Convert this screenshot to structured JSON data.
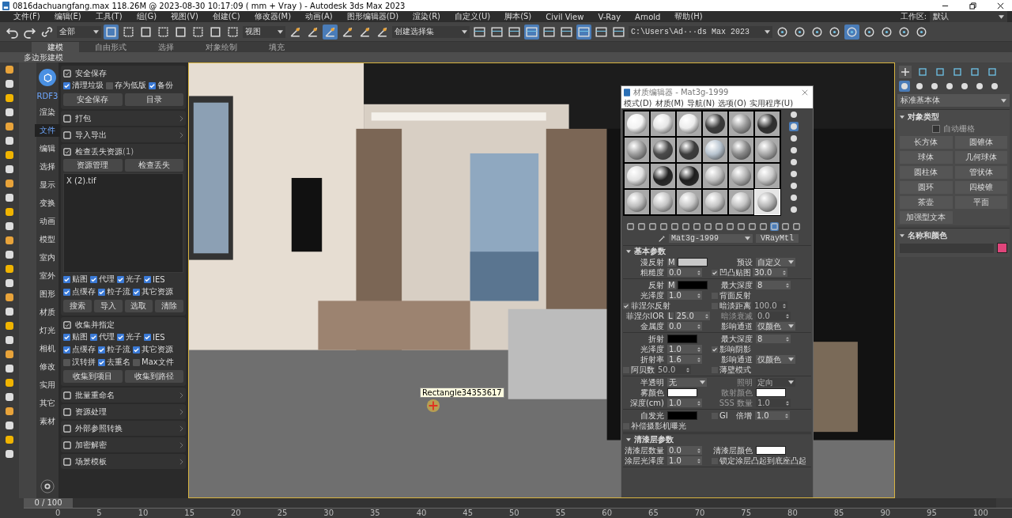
{
  "window": {
    "title": "0816dachuangfang.max  118.26M @ 2023-08-30 10:17:09  ( mm + Vray ) - Autodesk 3ds Max 2023"
  },
  "menu": [
    "文件(F)",
    "编辑(E)",
    "工具(T)",
    "组(G)",
    "视图(V)",
    "创建(C)",
    "修改器(M)",
    "动画(A)",
    "图形编辑器(D)",
    "渲染(R)",
    "自定义(U)",
    "脚本(S)",
    "Civil View",
    "V-Ray",
    "Arnold",
    "帮助(H)"
  ],
  "workspace": {
    "label": "工作区:",
    "value": "默认"
  },
  "toolbar": {
    "selection_filter": "全部",
    "reference_coord": "视图",
    "selection_set": "创建选择集",
    "project_path": "C:\\Users\\Ad···ds Max 2023"
  },
  "ribbon_tabs": [
    {
      "label": "建模",
      "selected": true
    },
    {
      "label": "自由形式",
      "selected": false
    },
    {
      "label": "选择",
      "selected": false
    },
    {
      "label": "对象绘制",
      "selected": false
    },
    {
      "label": "填充",
      "selected": false
    }
  ],
  "ribbon_subtab": "多边形建模",
  "plugin": {
    "logo": "RDF3",
    "nav": [
      {
        "label": "渲染",
        "selected": false
      },
      {
        "label": "文件",
        "selected": true
      },
      {
        "label": "编辑",
        "selected": false
      },
      {
        "label": "选择",
        "selected": false
      },
      {
        "label": "显示",
        "selected": false
      },
      {
        "label": "变换",
        "selected": false
      },
      {
        "label": "动画",
        "selected": false
      },
      {
        "label": "模型",
        "selected": false
      },
      {
        "label": "室内",
        "selected": false
      },
      {
        "label": "室外",
        "selected": false
      },
      {
        "label": "图形",
        "selected": false
      },
      {
        "label": "材质",
        "selected": false
      },
      {
        "label": "灯光",
        "selected": false
      },
      {
        "label": "相机",
        "selected": false
      },
      {
        "label": "修改",
        "selected": false
      },
      {
        "label": "实用",
        "selected": false
      },
      {
        "label": "其它",
        "selected": false
      },
      {
        "label": "素材",
        "selected": false
      }
    ],
    "sections": [
      {
        "title": "安全保存",
        "expanded": true,
        "checkbox_rows": [
          [
            {
              "label": "清理垃圾",
              "checked": true
            },
            {
              "label": "存为低版",
              "checked": false
            },
            {
              "label": "备份",
              "checked": true
            }
          ]
        ],
        "buttons": [
          "安全保存",
          "目录"
        ]
      },
      {
        "title": "打包",
        "expanded": false
      },
      {
        "title": "导入导出",
        "expanded": false
      },
      {
        "title": "检查丢失资源",
        "count": "(1)",
        "expanded": true,
        "top_buttons": [
          "资源管理",
          "检查丢失"
        ],
        "file_list": [
          "X (2).tif"
        ],
        "checkbox_rows": [
          [
            {
              "label": "贴图",
              "checked": true
            },
            {
              "label": "代理",
              "checked": true
            },
            {
              "label": "光子",
              "checked": true
            },
            {
              "label": "IES",
              "checked": true
            }
          ],
          [
            {
              "label": "点缓存",
              "checked": true
            },
            {
              "label": "粒子流",
              "checked": true
            },
            {
              "label": "其它资源",
              "checked": true
            }
          ]
        ],
        "buttons": [
          "搜索",
          "导入",
          "选取",
          "清除"
        ]
      },
      {
        "title": "收集并指定",
        "expanded": true,
        "checkbox_rows": [
          [
            {
              "label": "贴图",
              "checked": true
            },
            {
              "label": "代理",
              "checked": true
            },
            {
              "label": "光子",
              "checked": true
            },
            {
              "label": "IES",
              "checked": true
            }
          ],
          [
            {
              "label": "点缓存",
              "checked": true
            },
            {
              "label": "粒子流",
              "checked": true
            },
            {
              "label": "其它资源",
              "checked": true
            }
          ],
          [
            {
              "label": "汉转拼",
              "checked": false
            },
            {
              "label": "去重名",
              "checked": true
            },
            {
              "label": "Max文件",
              "checked": false
            }
          ]
        ],
        "buttons": [
          "收集到项目",
          "收集到路径"
        ]
      },
      {
        "title": "批量重命名",
        "expanded": false
      },
      {
        "title": "资源处理",
        "expanded": false
      },
      {
        "title": "外部参照转换",
        "expanded": false
      },
      {
        "title": "加密解密",
        "expanded": false
      },
      {
        "title": "场景模板",
        "expanded": false
      }
    ]
  },
  "viewport": {
    "tooltip": "Rectangle34353617"
  },
  "material_editor": {
    "title": "材质编辑器 - Mat3g-1999",
    "menu": [
      "模式(D)",
      "材质(M)",
      "导航(N)",
      "选项(O)",
      "实用程序(U)"
    ],
    "sample_slots": [
      {
        "selected": false
      },
      {
        "selected": false
      },
      {
        "selected": false
      },
      {
        "selected": false
      },
      {
        "selected": false
      },
      {
        "selected": false
      },
      {
        "selected": false
      },
      {
        "selected": false
      },
      {
        "selected": false
      },
      {
        "selected": false
      },
      {
        "selected": false
      },
      {
        "selected": false
      },
      {
        "selected": false
      },
      {
        "selected": false
      },
      {
        "selected": false
      },
      {
        "selected": false
      },
      {
        "selected": false
      },
      {
        "selected": false
      },
      {
        "selected": false
      },
      {
        "selected": false
      },
      {
        "selected": false
      },
      {
        "selected": false
      },
      {
        "selected": false
      },
      {
        "selected": true
      }
    ],
    "material_name": "Mat3g-1999",
    "material_type": "VRayMtl",
    "rollouts": [
      {
        "title": "基本参数",
        "groups": [
          [
            [
              {
                "label": "漫反射",
                "kind": "color",
                "color": "#c8c8c8",
                "badge": "M"
              },
              {
                "label": "预设",
                "kind": "dropdown",
                "value": "自定义"
              }
            ],
            [
              {
                "label": "粗糙度",
                "kind": "spinner",
                "value": "0.0"
              },
              {
                "label": "凹凸贴图",
                "checked": true,
                "kind": "spinner",
                "value": "30.0"
              }
            ]
          ],
          [
            [
              {
                "label": "反射",
                "kind": "color",
                "color": "#000000",
                "badge": "M"
              },
              {
                "label": "最大深度",
                "kind": "spinner",
                "value": "8"
              }
            ],
            [
              {
                "label": "光泽度",
                "kind": "spinner",
                "value": "1.0"
              },
              {
                "label": "背面反射",
                "checked": false
              }
            ],
            [
              {
                "label": "菲涅尔反射",
                "checked": true
              },
              {
                "label": "暗淡距离",
                "checked": false,
                "kind": "spinner",
                "value": "100.0",
                "disabled": true
              }
            ],
            [
              {
                "label": "菲涅尔IOR",
                "badge": "L",
                "kind": "spinner",
                "value": "25.0"
              },
              {
                "label": "暗淡衰减",
                "kind": "spinner",
                "value": "0.0",
                "disabled": true
              }
            ],
            [
              {
                "label": "金属度",
                "kind": "spinner",
                "value": "0.0"
              },
              {
                "label": "影响通道",
                "kind": "dropdown",
                "value": "仅颜色"
              }
            ]
          ],
          [
            [
              {
                "label": "折射",
                "kind": "color",
                "color": "#000000"
              },
              {
                "label": "最大深度",
                "kind": "spinner",
                "value": "8"
              }
            ],
            [
              {
                "label": "光泽度",
                "kind": "spinner",
                "value": "1.0"
              },
              {
                "label": "影响阴影",
                "checked": true
              }
            ],
            [
              {
                "label": "折射率",
                "kind": "spinner",
                "value": "1.6"
              },
              {
                "label": "影响通道",
                "kind": "dropdown",
                "value": "仅颜色"
              }
            ],
            [
              {
                "label": "阿贝数",
                "checked": false,
                "kind": "spinner",
                "value": "50.0",
                "disabled": true
              },
              {
                "label": "薄壁模式",
                "checked": false
              }
            ]
          ],
          [
            [
              {
                "label": "半透明",
                "kind": "dropdown",
                "value": "无"
              },
              {
                "label": "照明",
                "kind": "dropdown",
                "value": "定向",
                "disabled": true
              }
            ],
            [
              {
                "label": "雾颜色",
                "kind": "color",
                "color": "#ffffff"
              },
              {
                "label": "散射颜色",
                "kind": "color",
                "color": "#ffffff",
                "disabled": true
              }
            ],
            [
              {
                "label": "深度(cm)",
                "kind": "spinner",
                "value": "1.0"
              },
              {
                "label": "SSS 数量",
                "kind": "spinner",
                "value": "1.0",
                "disabled": true
              }
            ]
          ],
          [
            [
              {
                "label": "自发光",
                "kind": "color",
                "color": "#000000"
              },
              {
                "label": "GI",
                "checked": false
              },
              {
                "label": "倍增",
                "kind": "spinner",
                "value": "1.0"
              }
            ],
            [
              {
                "label": "补偿摄影机曝光",
                "checked": false
              }
            ]
          ]
        ]
      },
      {
        "title": "清漆层参数",
        "groups": [
          [
            [
              {
                "label": "清漆层数量",
                "kind": "spinner",
                "value": "0.0"
              },
              {
                "label": "清漆层颜色",
                "kind": "color",
                "color": "#ffffff"
              }
            ],
            [
              {
                "label": "涂层光泽度",
                "kind": "spinner",
                "value": "1.0"
              },
              {
                "label": "锁定涂层凸起到底座凸起",
                "checked": false
              }
            ]
          ]
        ]
      }
    ]
  },
  "command_panel": {
    "category": "标准基本体",
    "object_type": {
      "title": "对象类型",
      "autogrid": {
        "label": "自动栅格",
        "checked": false
      },
      "buttons": [
        "长方体",
        "圆锥体",
        "球体",
        "几何球体",
        "圆柱体",
        "管状体",
        "圆环",
        "四棱锥",
        "茶壶",
        "平面",
        "加强型文本"
      ]
    },
    "name_and_color": {
      "title": "名称和颜色",
      "color": "#e0457b"
    }
  },
  "timeline": {
    "frame": "0 / 100",
    "level": 0,
    "ticks": [
      "0",
      "5",
      "10",
      "15",
      "20",
      "25",
      "30",
      "35",
      "40",
      "45",
      "50",
      "55",
      "60",
      "65",
      "70",
      "75",
      "80",
      "85",
      "90",
      "95",
      "100"
    ]
  }
}
